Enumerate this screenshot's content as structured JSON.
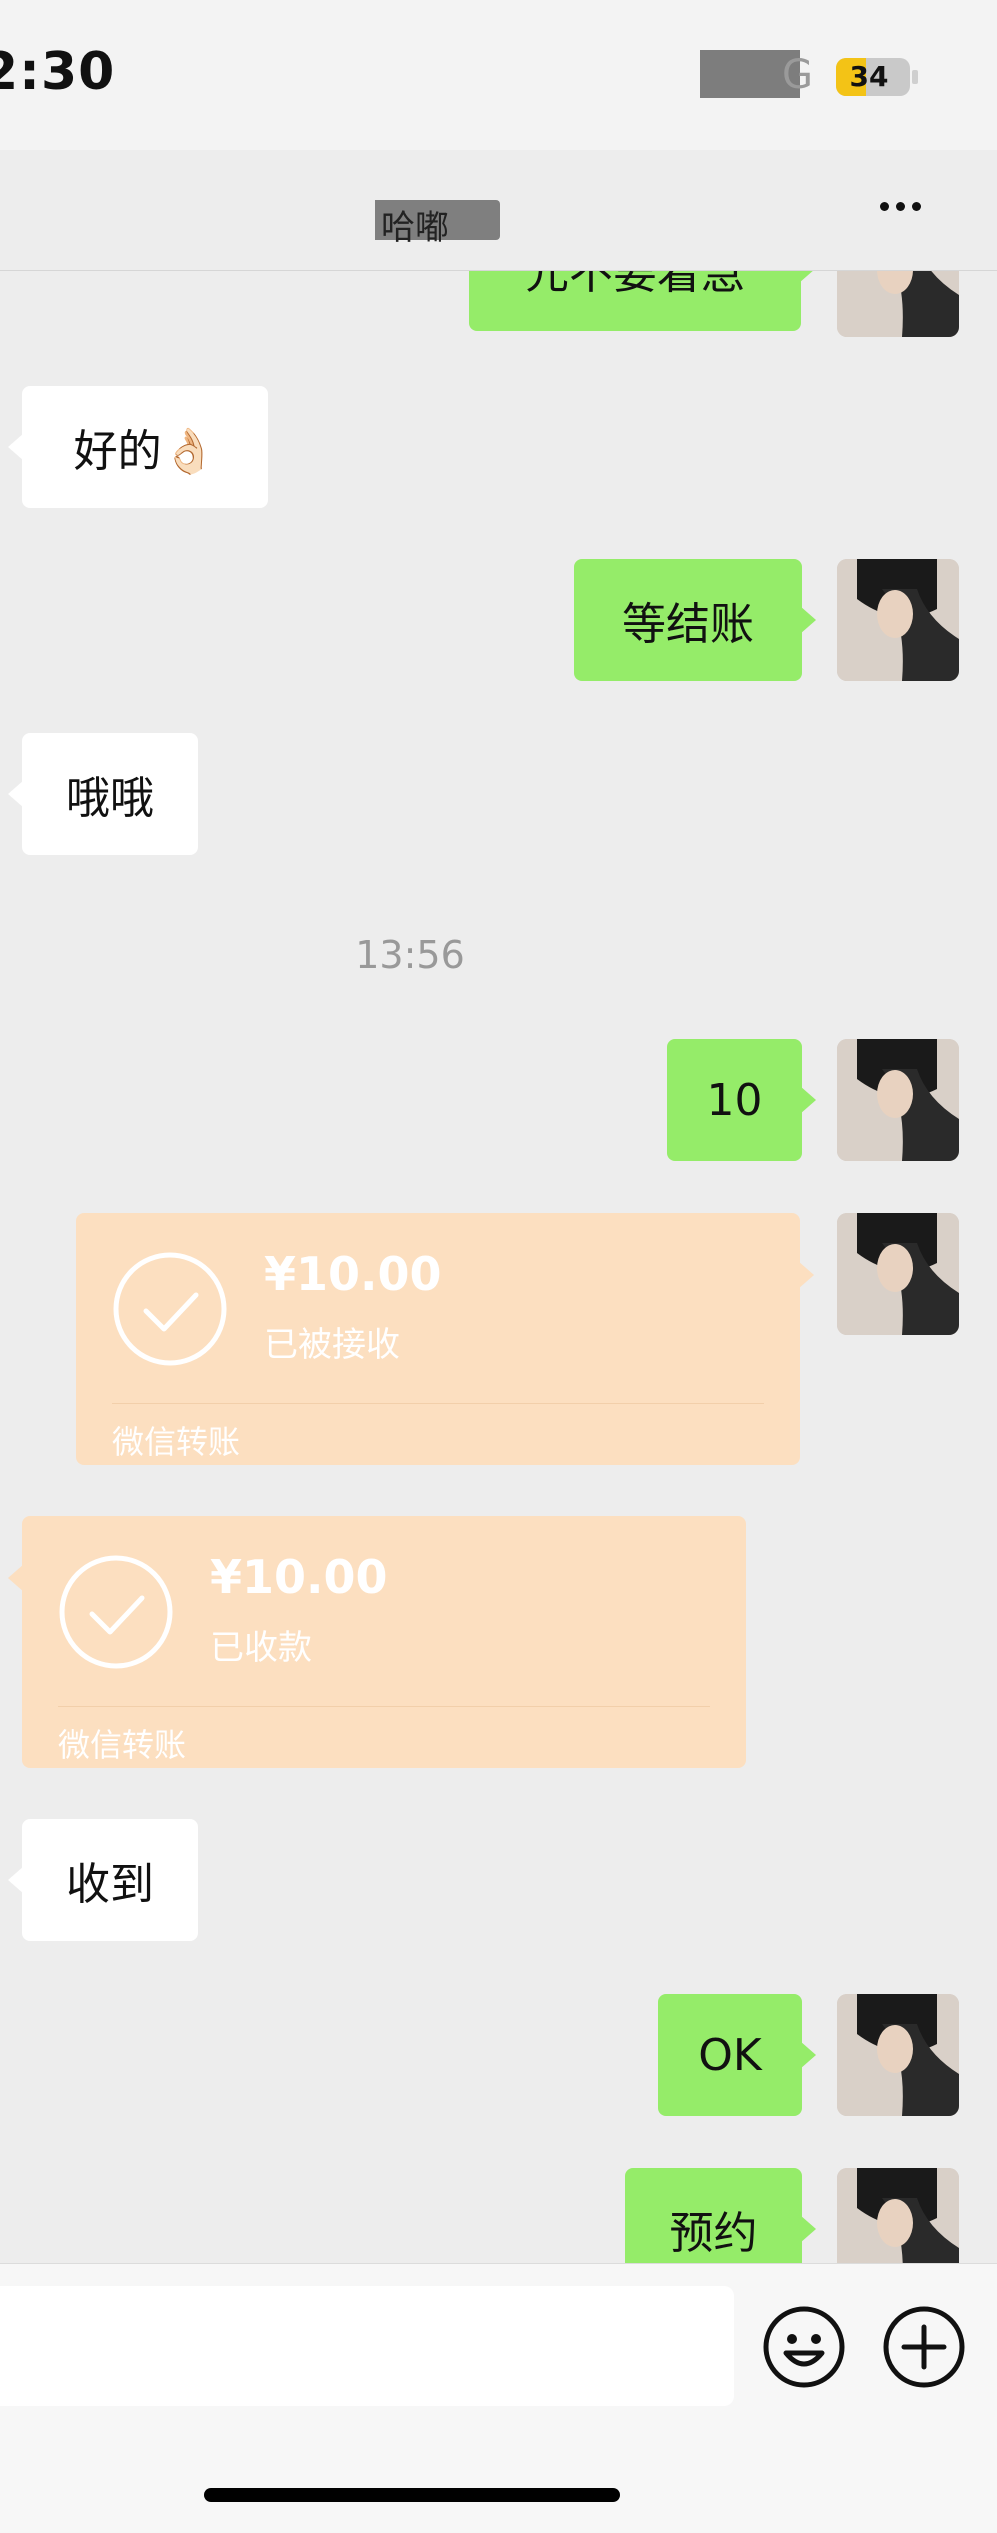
{
  "status_bar": {
    "time": "2:30",
    "network": "G",
    "battery": "34",
    "battery_level": 0.34
  },
  "header": {
    "title": "哈嘟"
  },
  "messages": [
    {
      "side": "out",
      "text": "元不要着急"
    },
    {
      "side": "in",
      "text": "好的👌🏻"
    },
    {
      "side": "out",
      "text": "等结账"
    },
    {
      "side": "in",
      "text": "哦哦"
    },
    {
      "type": "time",
      "text": "13:56"
    },
    {
      "side": "out",
      "text": "10"
    },
    {
      "side": "out",
      "type": "transfer",
      "amount": "¥10.00",
      "status": "已被接收",
      "footer": "微信转账"
    },
    {
      "side": "in",
      "type": "transfer",
      "amount": "¥10.00",
      "status": "已收款",
      "footer": "微信转账"
    },
    {
      "side": "in",
      "text": "收到"
    },
    {
      "side": "out",
      "text": "OK"
    },
    {
      "side": "out",
      "text": "预约"
    }
  ],
  "colors": {
    "outgoing_bubble": "#95ec69",
    "incoming_bubble": "#ffffff",
    "transfer_card": "#fcdfc0",
    "background": "#ededed"
  },
  "icons": {
    "more": "more-dots-icon",
    "emoji": "emoji-smile-icon",
    "plus": "plus-circle-icon",
    "check": "check-circle-icon"
  }
}
